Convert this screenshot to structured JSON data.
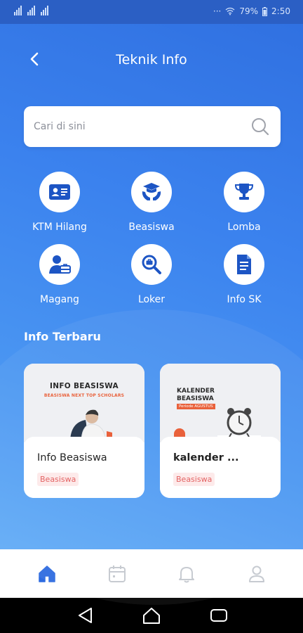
{
  "status_bar": {
    "battery": "79%",
    "time": "2:50"
  },
  "header": {
    "title": "Teknik Info"
  },
  "search": {
    "placeholder": "Cari di sini"
  },
  "menu": [
    {
      "label": "KTM Hilang",
      "icon": "id-card-icon"
    },
    {
      "label": "Beasiswa",
      "icon": "scholarship-icon"
    },
    {
      "label": "Lomba",
      "icon": "trophy-icon"
    },
    {
      "label": "Magang",
      "icon": "internship-icon"
    },
    {
      "label": "Loker",
      "icon": "job-search-icon"
    },
    {
      "label": "Info SK",
      "icon": "document-icon"
    }
  ],
  "section": {
    "title": "Info Terbaru"
  },
  "cards": [
    {
      "title": "Info Beasiswa",
      "tag": "Beasiswa",
      "image_heading": "INFO BEASISWA",
      "image_subheading": "BEASISWA NEXT TOP SCHOLARS"
    },
    {
      "title": "kalender ...",
      "tag": "Beasiswa",
      "image_heading_line1": "KALENDER",
      "image_heading_line2": "BEASISWA",
      "image_subheading": "Periode AGUSTUS"
    }
  ],
  "bottom_nav": [
    {
      "name": "home",
      "icon": "home-icon",
      "active": true
    },
    {
      "name": "calendar",
      "icon": "calendar-icon",
      "active": false
    },
    {
      "name": "notifications",
      "icon": "bell-icon",
      "active": false
    },
    {
      "name": "profile",
      "icon": "user-icon",
      "active": false
    }
  ],
  "colors": {
    "primary": "#2f6fe0",
    "nav_active": "#2d6be0",
    "nav_inactive": "#c4c8cf",
    "tag_text": "#e25a5a",
    "tag_bg": "#fde9e9"
  }
}
